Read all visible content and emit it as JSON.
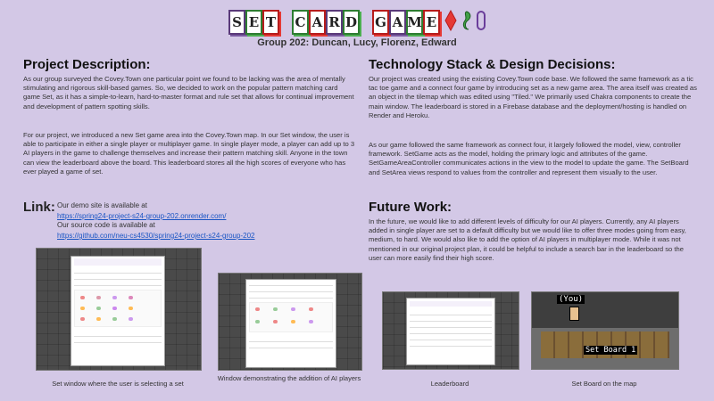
{
  "header": {
    "title_letters_1": [
      "S",
      "E",
      "T"
    ],
    "title_letters_2": [
      "C",
      "A",
      "R",
      "D"
    ],
    "title_letters_3": [
      "G",
      "A",
      "M",
      "E"
    ],
    "subtitle": "Group 202: Duncan, Lucy, Florenz, Edward"
  },
  "project": {
    "heading": "Project Description:",
    "p1": "As our group surveyed the Covey.Town one particular point we found to be lacking was the area of mentally stimulating and rigorous skill-based games. So, we decided to work on the popular pattern matching card game Set, as it has a simple-to-learn, hard-to-master format and rule set that allows for continual improvement and development of pattern spotting skills.",
    "p2": "For our project, we introduced a new Set game area into the Covey.Town map. In our Set window, the user is able to participate in either a single player or multiplayer game. In single player mode, a player can add up to 3 AI players in the game to challenge themselves and increase their pattern matching skill. Anyone in the town can view the leaderboard above the board. This leaderboard stores all the high scores of everyone who has ever played a game of set."
  },
  "links": {
    "heading": "Link:",
    "demo_text": "Our demo site is available at",
    "demo_url": "https://spring24-project-s24-group-202.onrender.com/",
    "source_text": "Our source code is available at",
    "source_url": "https://github.com/neu-cs4530/spring24-project-s24-group-202"
  },
  "tech": {
    "heading": "Technology Stack & Design Decisions:",
    "p1": "Our project was created using the existing Covey.Town code base. We followed the same framework as a tic tac toe game and a connect four game by introducing set as a new game area. The area itself was created as an object in the tilemap which was edited using \"Tiled.\" We primarily used Chakra components to create the main window. The leaderboard is stored in a Firebase database and the deployment/hosting is handled on Render and Heroku.",
    "p2": "As our game followed the same framework as connect four, it largely followed the model, view, controller framework. SetGame acts as the model, holding the primary logic and attributes of the game. SetGameAreaController communicates actions in the view to the model to update the game. The SetBoard and SetArea views respond to values from the controller and represent them visually to the user."
  },
  "future": {
    "heading": "Future Work:",
    "p1": "In the future, we would like to add different levels of difficulty for our AI players. Currently, any AI players added in single player are set to a default difficulty but we would like to offer three modes going from easy, medium, to hard. We would also like to add the option of AI players in multiplayer mode. While it was not mentioned in our original project plan, it could be helpful to include a search bar in the leaderboard so the user can more easily find their high score."
  },
  "screenshots": {
    "cap1": "Set window where the user is selecting a set",
    "cap2": "Window demonstrating the addition of AI players",
    "cap3": "Leaderboard",
    "cap4": "Set Board on the map",
    "you_label": "(You)",
    "board_label": "Set Board 1"
  },
  "colors": {
    "background": "#d3c8e6",
    "link": "#1a55c4"
  }
}
